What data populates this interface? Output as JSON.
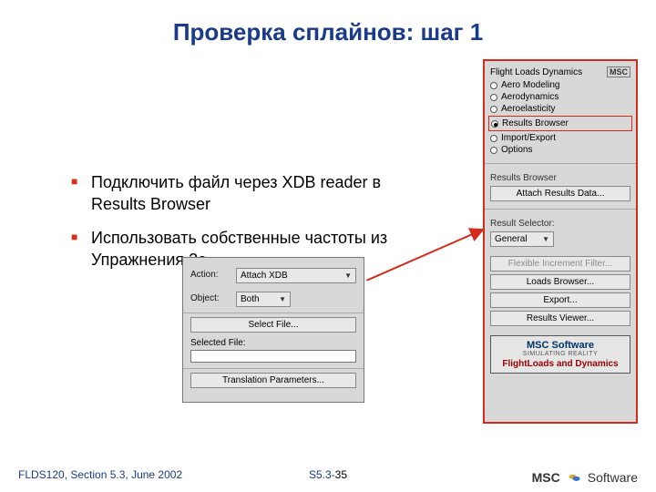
{
  "title": "Проверка сплайнов: шаг 1",
  "bullets": {
    "b1": "Подключить файл через XDB reader в Results Browser",
    "b2": "Использовать собственные частоты из Упражнения 2а"
  },
  "sidebar": {
    "header": "Flight Loads Dynamics",
    "brand": "MSC",
    "radios": {
      "r0": "Aero Modeling",
      "r1": "Aerodynamics",
      "r2": "Aeroelasticity",
      "r3": "Results Browser",
      "r4": "Import/Export",
      "r5": "Options"
    },
    "results_browser": {
      "label": "Results Browser",
      "btn": "Attach Results Data..."
    },
    "result_selector": {
      "label": "Result Selector:",
      "value": "General"
    },
    "buttons": {
      "flex": "Flexible Increment Filter...",
      "loads": "Loads Browser...",
      "export": "Export...",
      "viewer": "Results Viewer..."
    },
    "logo": {
      "brand": "MSC Software",
      "sub": "SIMULATING REALITY",
      "product": "FlightLoads and Dynamics"
    }
  },
  "panel2": {
    "action_lbl": "Action:",
    "action_val": "Attach XDB",
    "object_lbl": "Object:",
    "object_val": "Both",
    "select_file": "Select File...",
    "selected_file_lbl": "Selected File:",
    "translation": "Translation Parameters..."
  },
  "footer": {
    "left": "FLDS120, Section 5.3, June 2002",
    "center_prefix": "S5.3-",
    "center_page": "35",
    "right_msc": "MSC",
    "right_soft": "Software"
  }
}
